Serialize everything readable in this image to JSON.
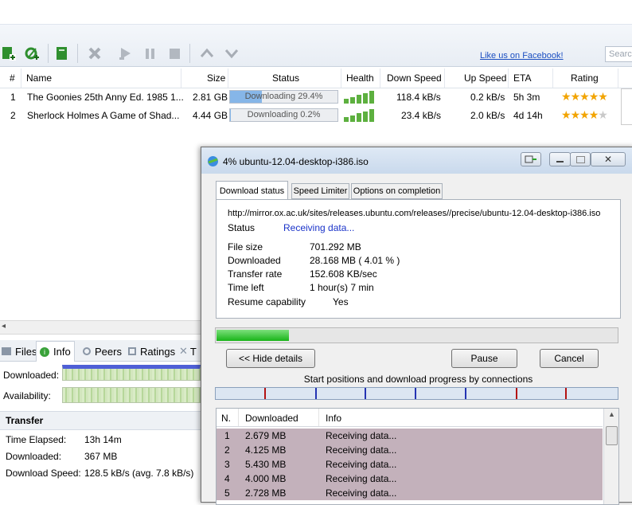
{
  "toolbar": {
    "facebook_link": "Like us on Facebook!",
    "search_placeholder": "Searc"
  },
  "list": {
    "columns": [
      "#",
      "Name",
      "Size",
      "Status",
      "Health",
      "Down Speed",
      "Up Speed",
      "ETA",
      "Rating"
    ],
    "rows": [
      {
        "num": "1",
        "name": "The Goonies 25th Anny Ed. 1985 1...",
        "size": "2.81 GB",
        "status": "Downloading 29.4%",
        "progress": 0.294,
        "health": 5,
        "down": "118.4 kB/s",
        "up": "0.2 kB/s",
        "eta": "5h 3m",
        "rating": 5
      },
      {
        "num": "2",
        "name": "Sherlock Holmes A Game of Shad...",
        "size": "4.44 GB",
        "status": "Downloading 0.2%",
        "progress": 0.002,
        "health": 5,
        "down": "23.4 kB/s",
        "up": "2.0 kB/s",
        "eta": "4d 14h",
        "rating": 4
      }
    ]
  },
  "bottom": {
    "tabs": [
      "Files",
      "Info",
      "Peers",
      "Ratings",
      "T"
    ],
    "downloaded_label": "Downloaded:",
    "availability_label": "Availability:",
    "transfer_title": "Transfer",
    "time_elapsed_label": "Time Elapsed:",
    "time_elapsed": "13h 14m",
    "downloaded2_label": "Downloaded:",
    "downloaded2": "367 MB",
    "download_speed_label": "Download Speed:",
    "download_speed": "128.5 kB/s (avg. 7.8 kB/s)"
  },
  "dialog": {
    "title": "4% ubuntu-12.04-desktop-i386.iso",
    "tabs": [
      "Download status",
      "Speed Limiter",
      "Options on completion"
    ],
    "url": "http://mirror.ox.ac.uk/sites/releases.ubuntu.com/releases//precise/ubuntu-12.04-desktop-i386.iso",
    "status_label": "Status",
    "status_value": "Receiving data...",
    "file_size_label": "File size",
    "file_size": "701.292  MB",
    "downloaded_label": "Downloaded",
    "downloaded": "28.168  MB  ( 4.01 % )",
    "transfer_rate_label": "Transfer rate",
    "transfer_rate": "152.608  KB/sec",
    "time_left_label": "Time left",
    "time_left": "1 hour(s) 7 min",
    "resume_label": "Resume capability",
    "resume": "Yes",
    "progress": 0.0401,
    "hide_details": "<< Hide details",
    "pause": "Pause",
    "cancel": "Cancel",
    "connections_label": "Start positions and download progress by connections",
    "conn_columns": [
      "N.",
      "Downloaded",
      "Info"
    ],
    "connections": [
      {
        "n": "1",
        "downloaded": "2.679  MB",
        "info": "Receiving data..."
      },
      {
        "n": "2",
        "downloaded": "4.125  MB",
        "info": "Receiving data..."
      },
      {
        "n": "3",
        "downloaded": "5.430  MB",
        "info": "Receiving data..."
      },
      {
        "n": "4",
        "downloaded": "4.000  MB",
        "info": "Receiving data..."
      },
      {
        "n": "5",
        "downloaded": "2.728  MB",
        "info": "Receiving data..."
      }
    ]
  }
}
